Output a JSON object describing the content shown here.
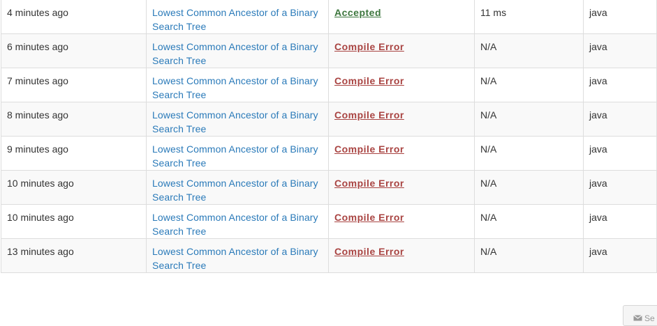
{
  "submissions": [
    {
      "time": "4 minutes ago",
      "problem": "Lowest Common Ancestor of a Binary Search Tree",
      "status": "Accepted",
      "status_kind": "accepted",
      "runtime": "11 ms",
      "language": "java"
    },
    {
      "time": "6 minutes ago",
      "problem": "Lowest Common Ancestor of a Binary Search Tree",
      "status": "Compile Error",
      "status_kind": "error",
      "runtime": "N/A",
      "language": "java"
    },
    {
      "time": "7 minutes ago",
      "problem": "Lowest Common Ancestor of a Binary Search Tree",
      "status": "Compile Error",
      "status_kind": "error",
      "runtime": "N/A",
      "language": "java"
    },
    {
      "time": "8 minutes ago",
      "problem": "Lowest Common Ancestor of a Binary Search Tree",
      "status": "Compile Error",
      "status_kind": "error",
      "runtime": "N/A",
      "language": "java"
    },
    {
      "time": "9 minutes ago",
      "problem": "Lowest Common Ancestor of a Binary Search Tree",
      "status": "Compile Error",
      "status_kind": "error",
      "runtime": "N/A",
      "language": "java"
    },
    {
      "time": "10 minutes ago",
      "problem": "Lowest Common Ancestor of a Binary Search Tree",
      "status": "Compile Error",
      "status_kind": "error",
      "runtime": "N/A",
      "language": "java"
    },
    {
      "time": "10 minutes ago",
      "problem": "Lowest Common Ancestor of a Binary Search Tree",
      "status": "Compile Error",
      "status_kind": "error",
      "runtime": "N/A",
      "language": "java"
    },
    {
      "time": "13 minutes ago",
      "problem": "Lowest Common Ancestor of a Binary Search Tree",
      "status": "Compile Error",
      "status_kind": "error",
      "runtime": "N/A",
      "language": "java"
    }
  ],
  "feedback": {
    "label": "Se",
    "icon": "envelope-icon"
  },
  "colors": {
    "link": "#2a7ab9",
    "accepted": "#3c763d",
    "error": "#a94442",
    "row_stripe": "#f9f9f9",
    "border": "#dddddd"
  }
}
